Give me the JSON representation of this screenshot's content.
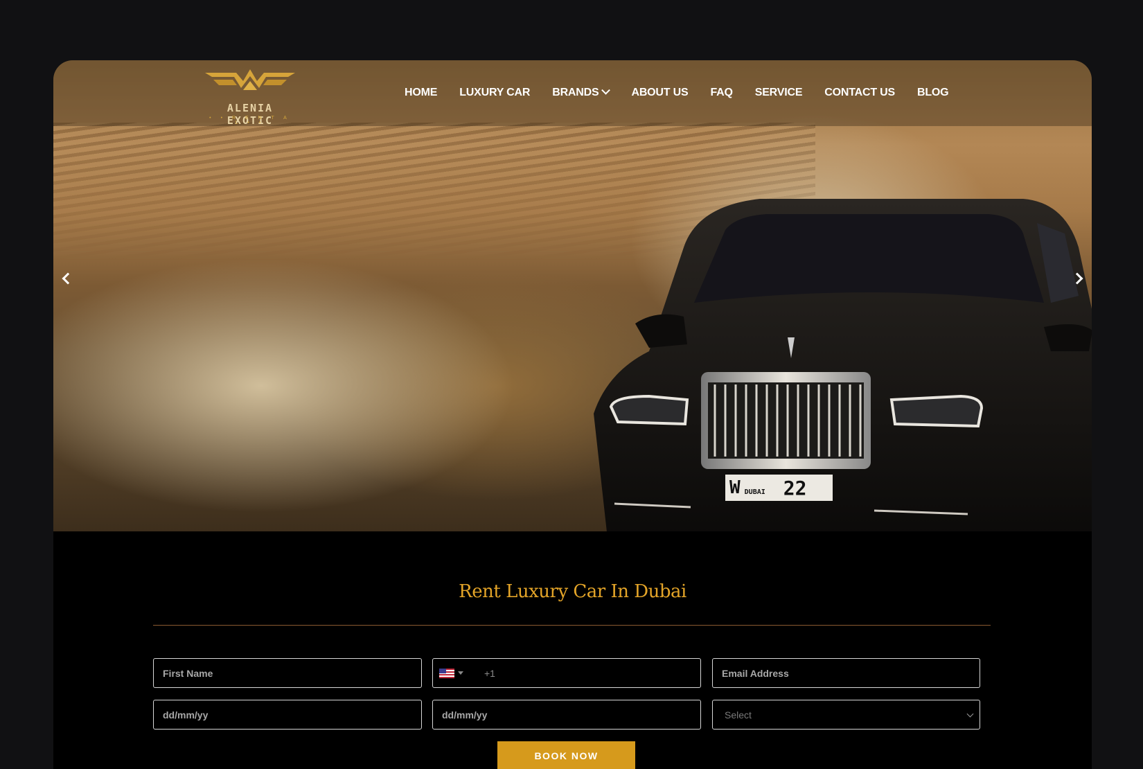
{
  "brand": {
    "logo_name": "ALENIA EXOTIC",
    "logo_sub": "• • R E N T A L • •"
  },
  "nav": {
    "items": [
      {
        "label": "HOME"
      },
      {
        "label": "LUXURY CAR"
      },
      {
        "label": "BRANDS"
      },
      {
        "label": "ABOUT US"
      },
      {
        "label": "FAQ"
      },
      {
        "label": "SERVICE"
      },
      {
        "label": "CONTACT US"
      },
      {
        "label": "BLOG"
      }
    ]
  },
  "hero": {
    "plate_letter": "W",
    "plate_city": "DUBAI",
    "plate_number": "22"
  },
  "booking": {
    "title": "Rent Luxury Car In Dubai",
    "first_name_placeholder": "First Name",
    "phone_code": "+1",
    "email_placeholder": "Email Address",
    "pickup_date_placeholder": "dd/mm/yy",
    "return_date_placeholder": "dd/mm/yy",
    "select_value": "Select",
    "submit_label": "BOOK NOW"
  },
  "colors": {
    "accent": "#d69a1c",
    "title": "#e3a428",
    "background": "#111113"
  }
}
